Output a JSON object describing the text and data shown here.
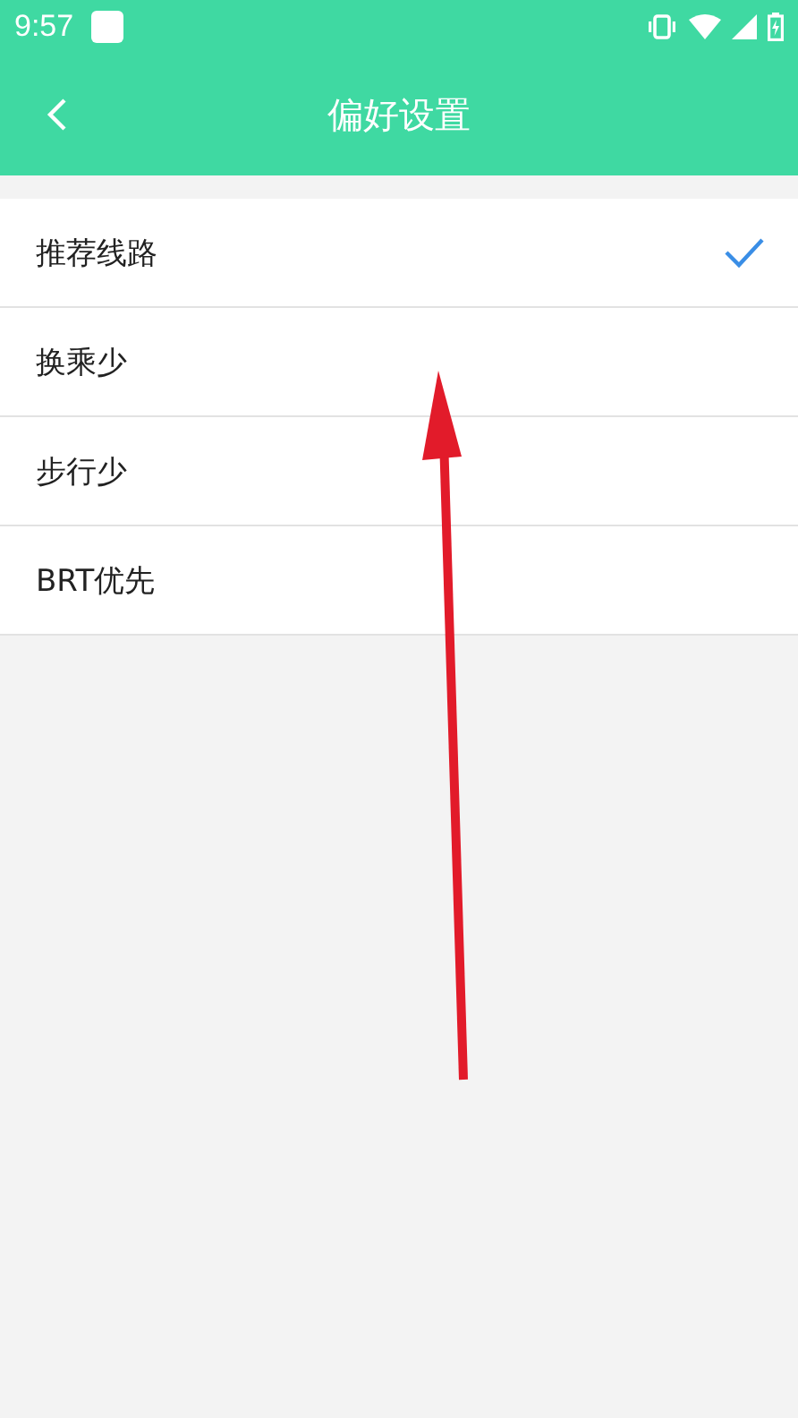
{
  "status_bar": {
    "time": "9:57"
  },
  "header": {
    "title": "偏好设置"
  },
  "options": [
    {
      "label": "推荐线路",
      "selected": true
    },
    {
      "label": "换乘少",
      "selected": false
    },
    {
      "label": "步行少",
      "selected": false
    },
    {
      "label": "BRT优先",
      "selected": false
    }
  ]
}
